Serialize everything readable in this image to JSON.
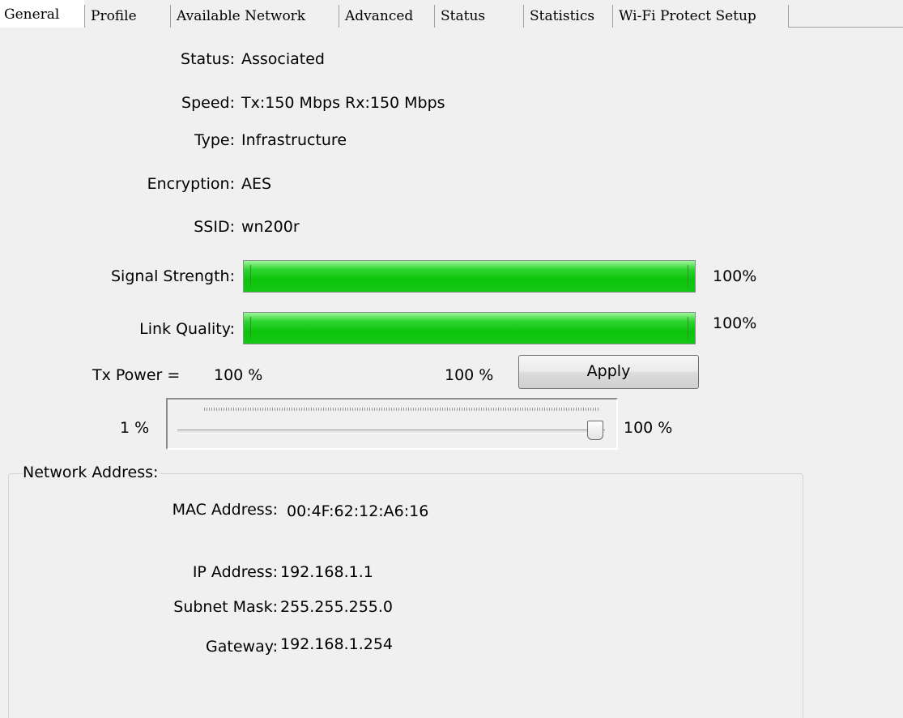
{
  "tabs": [
    {
      "label": "General",
      "active": true
    },
    {
      "label": "Profile",
      "active": false
    },
    {
      "label": "Available Network",
      "active": false
    },
    {
      "label": "Advanced",
      "active": false
    },
    {
      "label": "Status",
      "active": false
    },
    {
      "label": "Statistics",
      "active": false
    },
    {
      "label": "Wi-Fi Protect Setup",
      "active": false
    }
  ],
  "info": {
    "status": {
      "label": "Status:",
      "value": "Associated"
    },
    "speed": {
      "label": "Speed:",
      "value": "Tx:150 Mbps Rx:150 Mbps"
    },
    "type": {
      "label": "Type:",
      "value": "Infrastructure"
    },
    "encryption": {
      "label": "Encryption:",
      "value": "AES"
    },
    "ssid": {
      "label": "SSID:",
      "value": "wn200r"
    }
  },
  "signal": {
    "label": "Signal Strength:",
    "value_text": "100%",
    "level": 100
  },
  "link": {
    "label": "Link Quality:",
    "value_text": "100%",
    "level": 100
  },
  "txpower": {
    "label": "Tx Power =",
    "current": "100 %",
    "selected": "100 %",
    "apply_label": "Apply",
    "min_label": "1 %",
    "max_label": "100 %",
    "slider_level": 100
  },
  "network": {
    "title": "Network Address:",
    "mac": {
      "label": "MAC Address:",
      "value": "00:4F:62:12:A6:16"
    },
    "ip": {
      "label": "IP Address:",
      "value": "192.168.1.1"
    },
    "subnet": {
      "label": "Subnet Mask:",
      "value": "255.255.255.0"
    },
    "gateway": {
      "label": "Gateway:",
      "value": "192.168.1.254"
    }
  },
  "colors": {
    "progress_fill": "#0cc40c",
    "window_bg": "#f0f0f0"
  }
}
